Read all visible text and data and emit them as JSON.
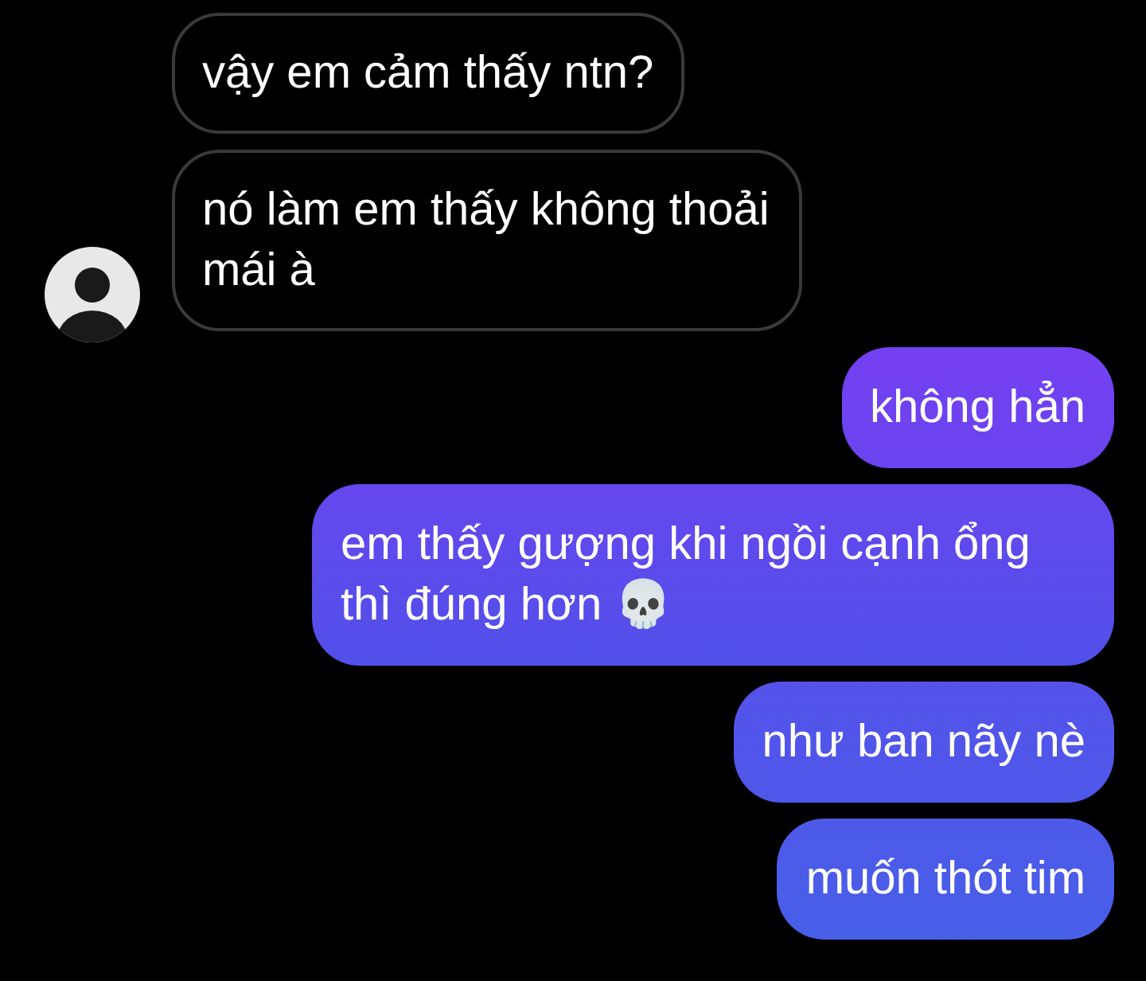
{
  "messages": [
    {
      "kind": "received",
      "text": "vậy em cảm thấy ntn?",
      "show_avatar": false
    },
    {
      "kind": "received",
      "text": "nó làm em thấy không thoải mái à",
      "show_avatar": true
    },
    {
      "kind": "sent",
      "text": "không hẳn"
    },
    {
      "kind": "sent",
      "text": "em thấy gượng khi ngồi cạnh ổng thì đúng hơn 💀"
    },
    {
      "kind": "sent",
      "text": "như ban nãy nè"
    },
    {
      "kind": "sent",
      "text": "muốn thót tim"
    }
  ]
}
